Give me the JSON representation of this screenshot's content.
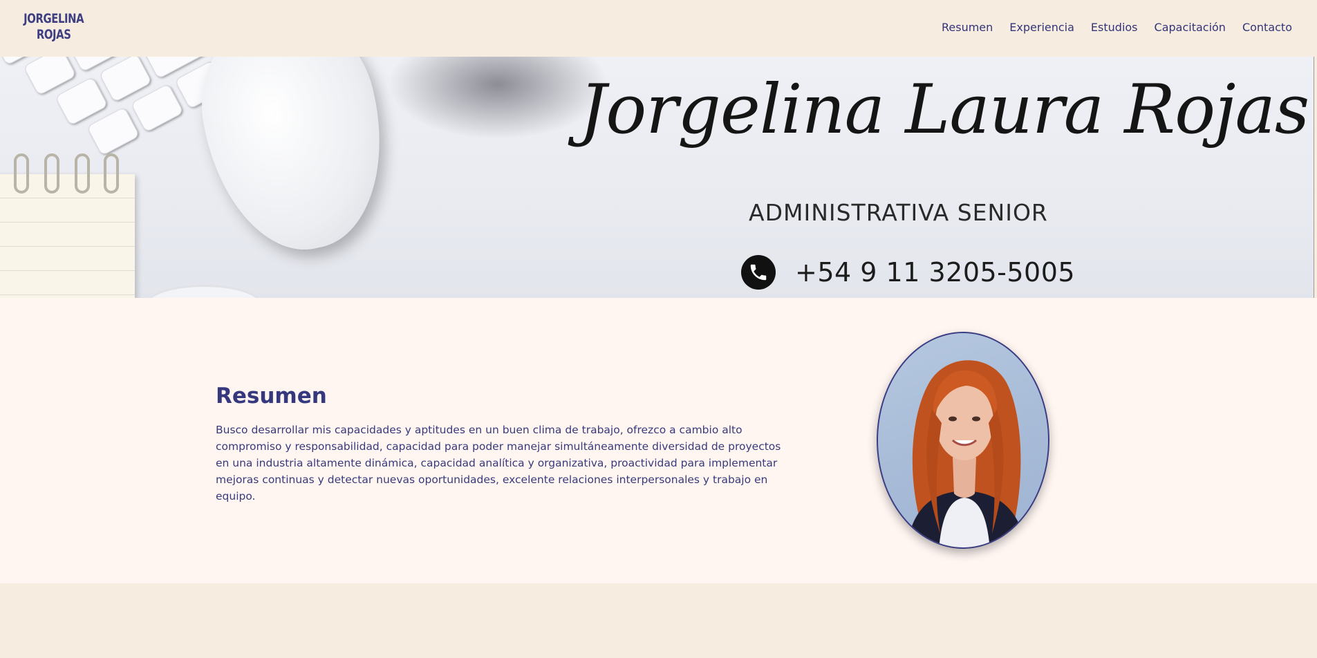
{
  "header": {
    "logo_line1": "JORGELINA",
    "logo_line2": "ROJAS",
    "nav": [
      {
        "label": "Resumen"
      },
      {
        "label": "Experiencia"
      },
      {
        "label": "Estudios"
      },
      {
        "label": "Capacitación"
      },
      {
        "label": "Contacto"
      }
    ]
  },
  "hero": {
    "signature": "Jorgelina Laura Rojas",
    "subtitle": "ADMINISTRATIVA SENIOR",
    "phone": "+54 9 11 3205-5005",
    "phone_icon": "phone-icon"
  },
  "resumen": {
    "title": "Resumen",
    "body": "Busco desarrollar mis capacidades y aptitudes en un buen clima de trabajo, ofrezco a cambio alto compromiso y responsabilidad, capacidad para poder manejar simultáneamente diversidad de proyectos en una industria altamente dinámica, capacidad analítica y organizativa, proactividad para implementar mejoras continuas y detectar nuevas oportunidades, excelente relaciones interpersonales y trabajo en equipo."
  },
  "colors": {
    "header_bg": "#f7ece0",
    "section_bg": "#fff6f2",
    "accent": "#36387e"
  }
}
